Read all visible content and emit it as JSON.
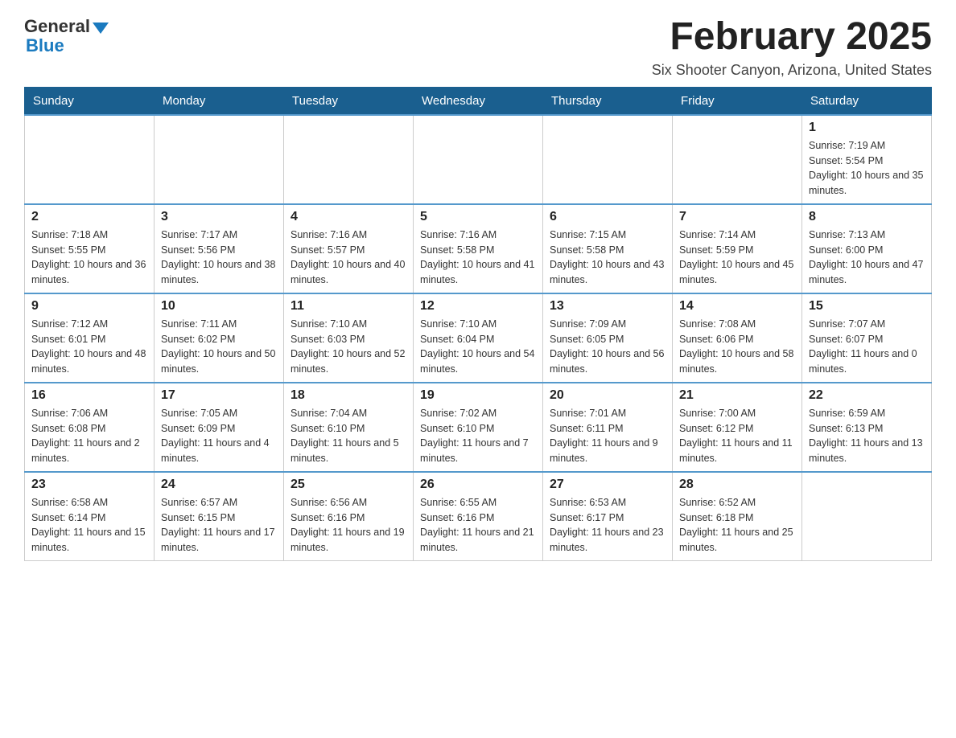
{
  "header": {
    "logo_general": "General",
    "logo_blue": "Blue",
    "month_title": "February 2025",
    "location": "Six Shooter Canyon, Arizona, United States"
  },
  "days_of_week": [
    "Sunday",
    "Monday",
    "Tuesday",
    "Wednesday",
    "Thursday",
    "Friday",
    "Saturday"
  ],
  "weeks": [
    [
      {
        "day": "",
        "info": ""
      },
      {
        "day": "",
        "info": ""
      },
      {
        "day": "",
        "info": ""
      },
      {
        "day": "",
        "info": ""
      },
      {
        "day": "",
        "info": ""
      },
      {
        "day": "",
        "info": ""
      },
      {
        "day": "1",
        "info": "Sunrise: 7:19 AM\nSunset: 5:54 PM\nDaylight: 10 hours and 35 minutes."
      }
    ],
    [
      {
        "day": "2",
        "info": "Sunrise: 7:18 AM\nSunset: 5:55 PM\nDaylight: 10 hours and 36 minutes."
      },
      {
        "day": "3",
        "info": "Sunrise: 7:17 AM\nSunset: 5:56 PM\nDaylight: 10 hours and 38 minutes."
      },
      {
        "day": "4",
        "info": "Sunrise: 7:16 AM\nSunset: 5:57 PM\nDaylight: 10 hours and 40 minutes."
      },
      {
        "day": "5",
        "info": "Sunrise: 7:16 AM\nSunset: 5:58 PM\nDaylight: 10 hours and 41 minutes."
      },
      {
        "day": "6",
        "info": "Sunrise: 7:15 AM\nSunset: 5:58 PM\nDaylight: 10 hours and 43 minutes."
      },
      {
        "day": "7",
        "info": "Sunrise: 7:14 AM\nSunset: 5:59 PM\nDaylight: 10 hours and 45 minutes."
      },
      {
        "day": "8",
        "info": "Sunrise: 7:13 AM\nSunset: 6:00 PM\nDaylight: 10 hours and 47 minutes."
      }
    ],
    [
      {
        "day": "9",
        "info": "Sunrise: 7:12 AM\nSunset: 6:01 PM\nDaylight: 10 hours and 48 minutes."
      },
      {
        "day": "10",
        "info": "Sunrise: 7:11 AM\nSunset: 6:02 PM\nDaylight: 10 hours and 50 minutes."
      },
      {
        "day": "11",
        "info": "Sunrise: 7:10 AM\nSunset: 6:03 PM\nDaylight: 10 hours and 52 minutes."
      },
      {
        "day": "12",
        "info": "Sunrise: 7:10 AM\nSunset: 6:04 PM\nDaylight: 10 hours and 54 minutes."
      },
      {
        "day": "13",
        "info": "Sunrise: 7:09 AM\nSunset: 6:05 PM\nDaylight: 10 hours and 56 minutes."
      },
      {
        "day": "14",
        "info": "Sunrise: 7:08 AM\nSunset: 6:06 PM\nDaylight: 10 hours and 58 minutes."
      },
      {
        "day": "15",
        "info": "Sunrise: 7:07 AM\nSunset: 6:07 PM\nDaylight: 11 hours and 0 minutes."
      }
    ],
    [
      {
        "day": "16",
        "info": "Sunrise: 7:06 AM\nSunset: 6:08 PM\nDaylight: 11 hours and 2 minutes."
      },
      {
        "day": "17",
        "info": "Sunrise: 7:05 AM\nSunset: 6:09 PM\nDaylight: 11 hours and 4 minutes."
      },
      {
        "day": "18",
        "info": "Sunrise: 7:04 AM\nSunset: 6:10 PM\nDaylight: 11 hours and 5 minutes."
      },
      {
        "day": "19",
        "info": "Sunrise: 7:02 AM\nSunset: 6:10 PM\nDaylight: 11 hours and 7 minutes."
      },
      {
        "day": "20",
        "info": "Sunrise: 7:01 AM\nSunset: 6:11 PM\nDaylight: 11 hours and 9 minutes."
      },
      {
        "day": "21",
        "info": "Sunrise: 7:00 AM\nSunset: 6:12 PM\nDaylight: 11 hours and 11 minutes."
      },
      {
        "day": "22",
        "info": "Sunrise: 6:59 AM\nSunset: 6:13 PM\nDaylight: 11 hours and 13 minutes."
      }
    ],
    [
      {
        "day": "23",
        "info": "Sunrise: 6:58 AM\nSunset: 6:14 PM\nDaylight: 11 hours and 15 minutes."
      },
      {
        "day": "24",
        "info": "Sunrise: 6:57 AM\nSunset: 6:15 PM\nDaylight: 11 hours and 17 minutes."
      },
      {
        "day": "25",
        "info": "Sunrise: 6:56 AM\nSunset: 6:16 PM\nDaylight: 11 hours and 19 minutes."
      },
      {
        "day": "26",
        "info": "Sunrise: 6:55 AM\nSunset: 6:16 PM\nDaylight: 11 hours and 21 minutes."
      },
      {
        "day": "27",
        "info": "Sunrise: 6:53 AM\nSunset: 6:17 PM\nDaylight: 11 hours and 23 minutes."
      },
      {
        "day": "28",
        "info": "Sunrise: 6:52 AM\nSunset: 6:18 PM\nDaylight: 11 hours and 25 minutes."
      },
      {
        "day": "",
        "info": ""
      }
    ]
  ]
}
